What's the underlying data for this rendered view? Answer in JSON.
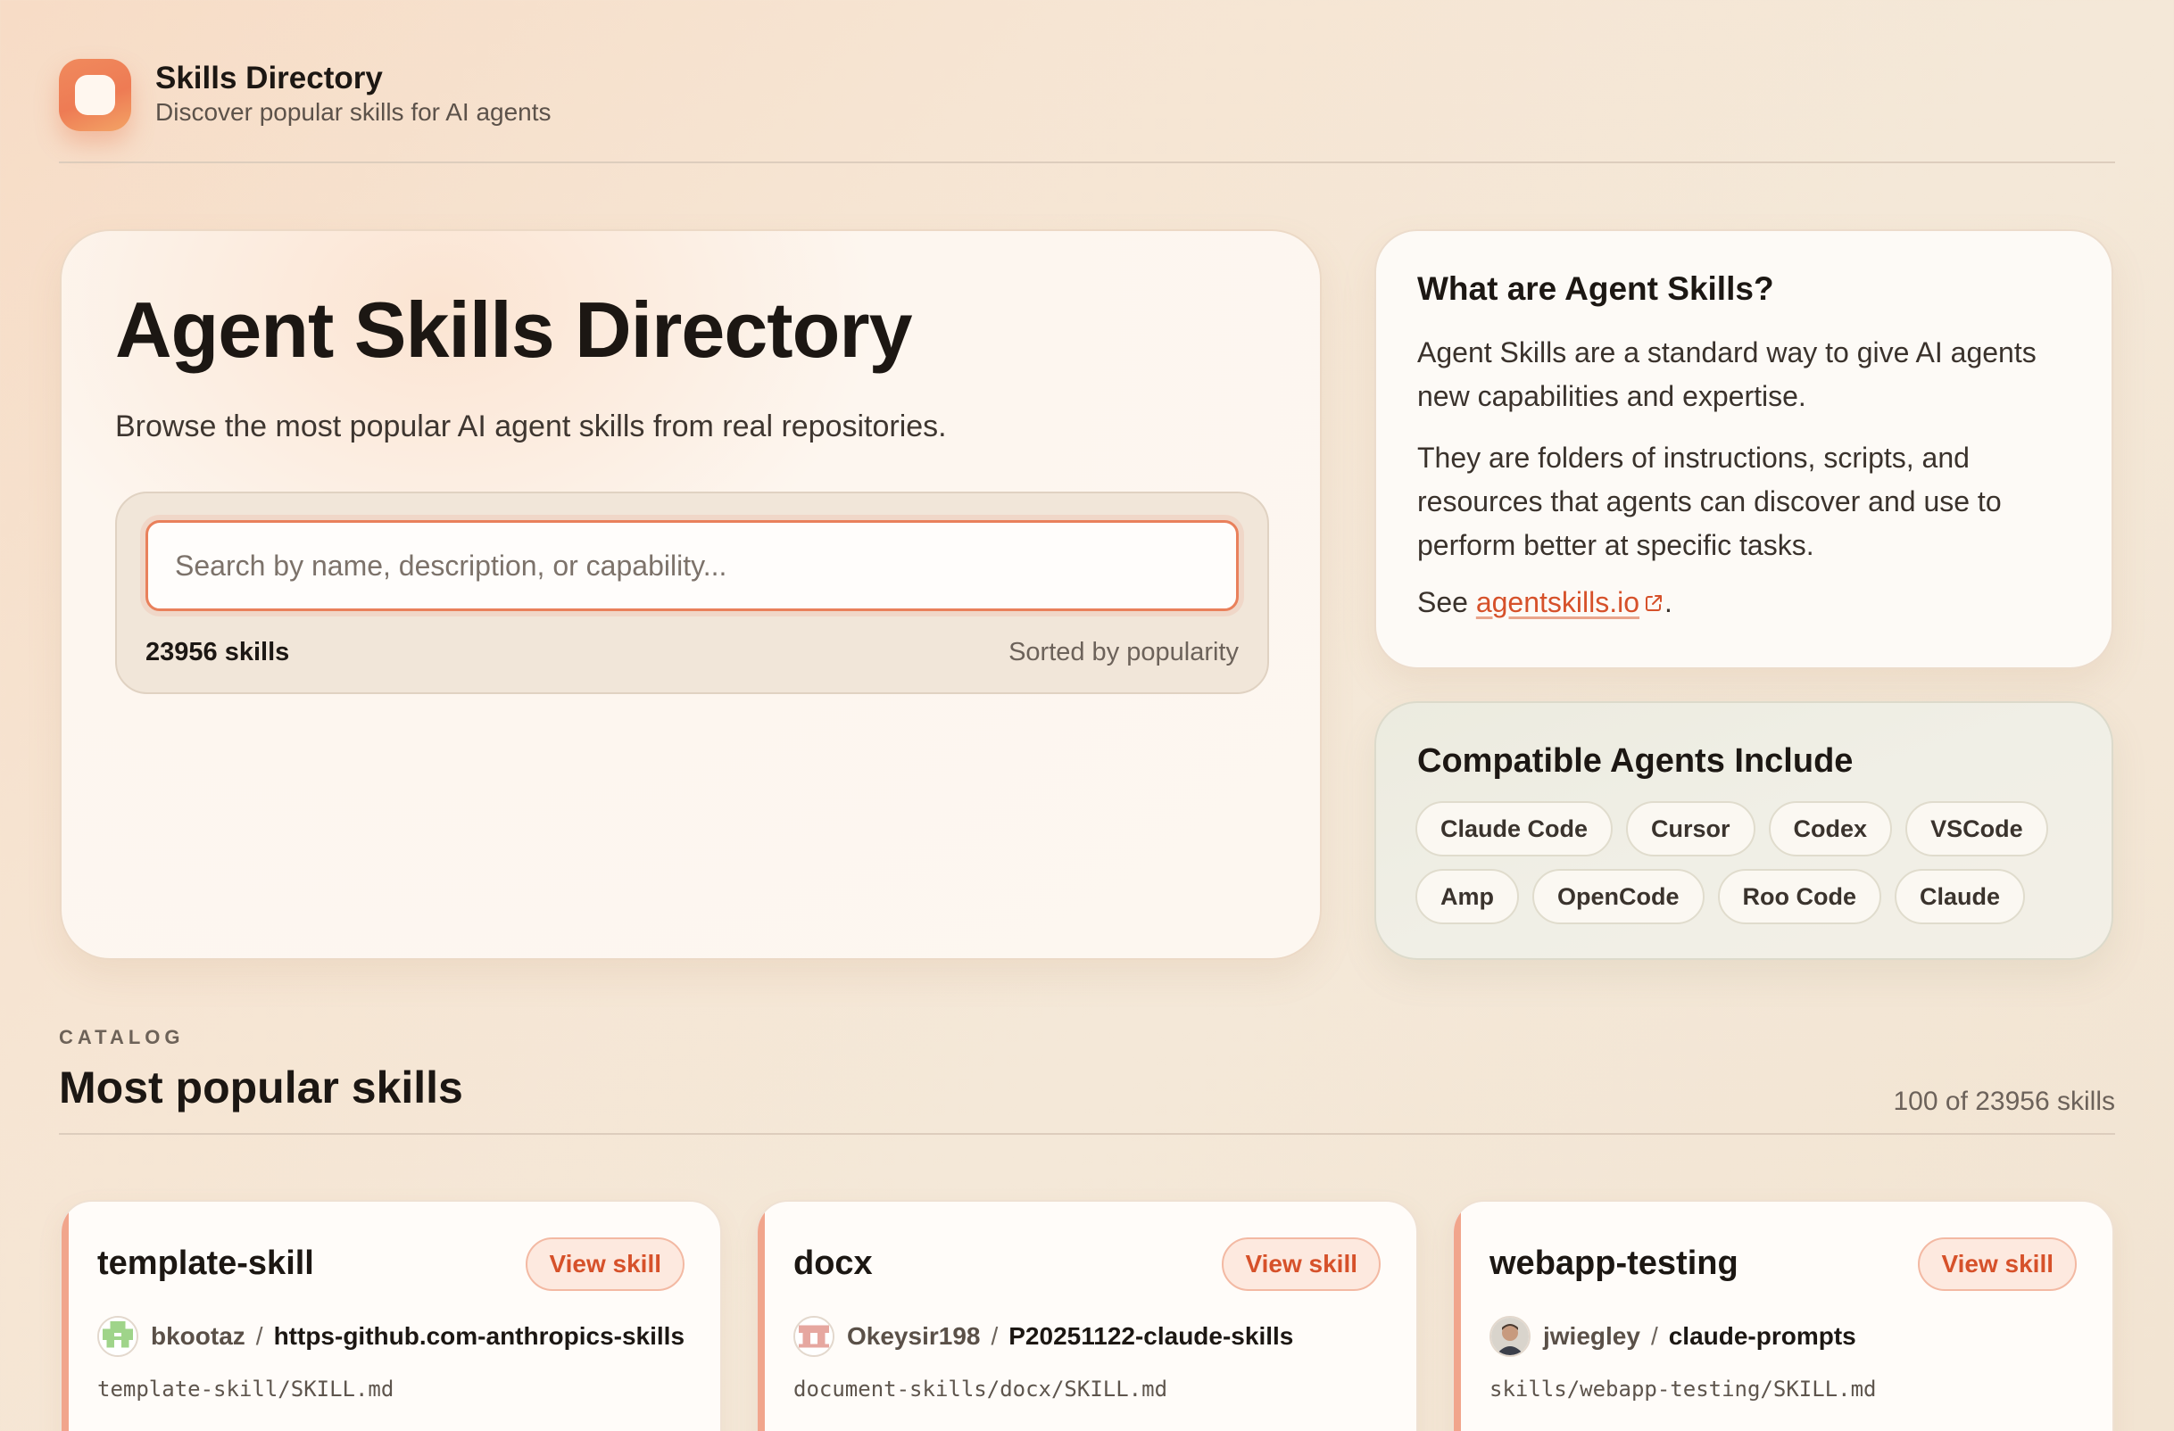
{
  "header": {
    "title": "Skills Directory",
    "subtitle": "Discover popular skills for AI agents"
  },
  "hero": {
    "title": "Agent Skills Directory",
    "subtitle": "Browse the most popular AI agent skills from real repositories.",
    "search": {
      "placeholder": "Search by name, description, or capability...",
      "value": ""
    },
    "count_label": "23956 skills",
    "sort_label": "Sorted by popularity"
  },
  "info": {
    "title": "What are Agent Skills?",
    "paragraph1": "Agent Skills are a standard way to give AI agents new capabilities and expertise.",
    "paragraph2": "They are folders of instructions, scripts, and resources that agents can discover and use to perform better at specific tasks.",
    "see_prefix": "See ",
    "link_text": "agentskills.io",
    "see_suffix": "."
  },
  "agents": {
    "title": "Compatible Agents Include",
    "items": [
      "Claude Code",
      "Cursor",
      "Codex",
      "VSCode",
      "Amp",
      "OpenCode",
      "Roo Code",
      "Claude"
    ]
  },
  "catalog": {
    "eyebrow": "CATALOG",
    "title": "Most popular skills",
    "count_label": "100 of 23956 skills"
  },
  "skills": [
    {
      "name": "template-skill",
      "button_label": "View skill",
      "user": "bkootaz",
      "separator": "/",
      "repo": "https-github.com-anthropics-skills",
      "path": "template-skill/SKILL.md",
      "avatar_icon": "pixel-avatar-green"
    },
    {
      "name": "docx",
      "button_label": "View skill",
      "user": "Okeysir198",
      "separator": "/",
      "repo": "P20251122-claude-skills",
      "path": "document-skills/docx/SKILL.md",
      "avatar_icon": "pixel-avatar-pink"
    },
    {
      "name": "webapp-testing",
      "button_label": "View skill",
      "user": "jwiegley",
      "separator": "/",
      "repo": "claude-prompts",
      "path": "skills/webapp-testing/SKILL.md",
      "avatar_icon": "photo-avatar"
    }
  ],
  "colors": {
    "accent": "#d6512a",
    "logo": "#ee7b54",
    "background": "#f5e6d6"
  }
}
